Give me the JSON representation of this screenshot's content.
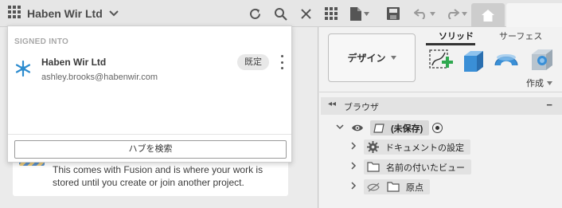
{
  "topbar": {
    "hub_name": "Haben Wir Ltd",
    "icons": [
      "app-grid-icon",
      "refresh-icon",
      "search-icon",
      "close-icon",
      "data-panel-icon",
      "file-icon",
      "save-icon",
      "undo-icon",
      "redo-icon",
      "home-icon"
    ]
  },
  "account_popup": {
    "section_label": "SIGNED INTO",
    "hub_name": "Haben Wir Ltd",
    "email": "ashley.brooks@habenwir.com",
    "default_badge": "既定",
    "search_hub_button": "ハブを検索"
  },
  "project_card": {
    "text": "This comes with Fusion and is where your work is stored until you create or join another project."
  },
  "design_panel": {
    "workspace_button": "デザイン",
    "tabs": [
      "ソリッド",
      "サーフェス"
    ],
    "active_tab": "ソリッド",
    "create_menu": "作成"
  },
  "browser": {
    "title": "ブラウザ",
    "items": [
      {
        "label": "(未保存)",
        "kind": "document"
      },
      {
        "label": "ドキュメントの設定",
        "kind": "settings"
      },
      {
        "label": "名前の付いたビュー",
        "kind": "folder"
      },
      {
        "label": "原点",
        "kind": "origin"
      }
    ]
  },
  "colors": {
    "accent_green": "#2fa84f",
    "accent_blue": "#3a8fd6",
    "hub_logo": "#2d8ccf"
  }
}
